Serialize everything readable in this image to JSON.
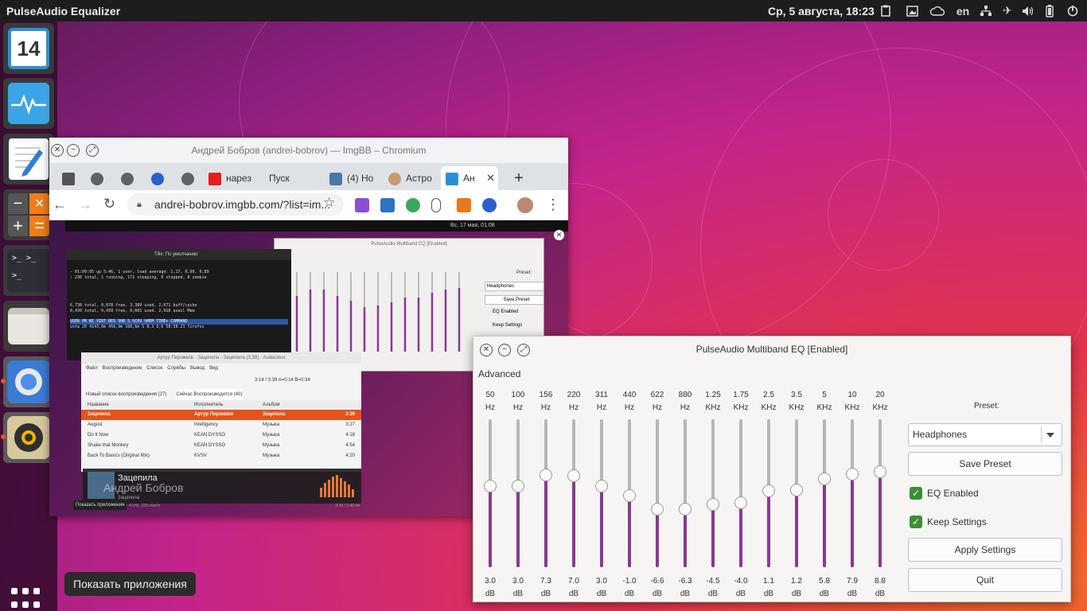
{
  "topbar": {
    "app_name": "PulseAudio Equalizer",
    "datetime": "Ср, 5 августа, 18:23",
    "language": "en"
  },
  "dock": {
    "items": [
      "calendar",
      "system-monitor",
      "text-editor",
      "calculator",
      "terminal",
      "files",
      "chromium",
      "rhythmbox"
    ],
    "show_apps_tooltip": "Показать приложения"
  },
  "chromium": {
    "window_title": "Андрей Бобров (andrei-bobrov) — ImgBB – Chromium",
    "tabs": [
      {
        "label": "нарез"
      },
      {
        "label": "Пуск"
      },
      {
        "label": "(4) Но"
      },
      {
        "label": "Астро"
      },
      {
        "label": "Ан"
      }
    ],
    "url": "andrei-bobrov.imgbb.com/?list=im...",
    "new_tab": "+",
    "content": {
      "panel_datetime": "Вс, 17 мая, 01:08",
      "terminal_title": "Tilix: По умолчанию",
      "top_lines": [
        "- 01:09:05 up  5:46,  1 user,  load average: 1,17, 0,99, 0,89",
        ": 236 total,   1 running, 171 sleeping,   0 stopped,   0 zombie",
        "6,738 total,   0,678 free,   3,389 used,   2,671 buff/cache",
        "0,439 total,   0,439 free,   0,001 used.   2,918 avail Mem"
      ],
      "top_header": "USER  PR  NI   VIRT   RES   SHR S  %CPU %MEM     TIME+  COMMAND",
      "top_row": "vota  20   4143,6m 456,9m 168,6m S  8,3  6,6  58:58.21  firefox",
      "audacious_title": "Артур Пирожков - Зацепила - Зацепила (3:39) - Audacious",
      "audacious_menu": [
        "Файл",
        "Воспроизведение",
        "Список",
        "Службы",
        "Вывод",
        "Вид"
      ],
      "audacious_time": "3:14 / 3:39 A=0:14 B=0:34",
      "playlist_tabs": [
        "Новый список воспроизведения (27)",
        "Сейчас Воспроизводится (40)"
      ],
      "playlist_headers": [
        "Название",
        "Исполнитель",
        "Альбом"
      ],
      "playlist_rows": [
        {
          "title": "Зацепила",
          "artist": "Артур Пирожков",
          "album": "Зацепила",
          "time": "3:39"
        },
        {
          "title": "August",
          "artist": "Intelligency",
          "album": "Музыка",
          "time": "3:27"
        },
        {
          "title": "Do It Now",
          "artist": "KEAN DYSSO",
          "album": "Музыка",
          "time": "4:18"
        },
        {
          "title": "Shake that Monkey",
          "artist": "KEAN DYSSO",
          "album": "Музыка",
          "time": "4:54"
        },
        {
          "title": "Back To Basics (Original Mix)",
          "artist": "KVSV",
          "album": "Музыка",
          "time": "4:20"
        }
      ],
      "status": "4 kHz, 320 кбит/с",
      "status_time": "3:39 / 2:40:44",
      "now_playing_title": "Зацепила",
      "now_playing_user": "Андрей Бобров",
      "now_playing_album": "Зацепила",
      "mini_eq_title": "PulseAudio Multiband EQ [Enabled]",
      "mini_preset_label": "Preset:",
      "mini_preset": "Headphones",
      "mini_save": "Save Preset",
      "mini_eq_enabled": "EQ Enabled",
      "mini_keep": "Keep Settings",
      "show_apps_tooltip": "Показать приложения"
    }
  },
  "eq": {
    "window_title": "PulseAudio Multiband EQ [Enabled]",
    "advanced_label": "Advanced",
    "bands": [
      {
        "freq": "50",
        "unit": "Hz",
        "value": "3.0",
        "db": "dB",
        "level": 3.0
      },
      {
        "freq": "100",
        "unit": "Hz",
        "value": "3.0",
        "db": "dB",
        "level": 3.0
      },
      {
        "freq": "156",
        "unit": "Hz",
        "value": "7.3",
        "db": "dB",
        "level": 7.3
      },
      {
        "freq": "220",
        "unit": "Hz",
        "value": "7.0",
        "db": "dB",
        "level": 7.0
      },
      {
        "freq": "311",
        "unit": "Hz",
        "value": "3.0",
        "db": "dB",
        "level": 3.0
      },
      {
        "freq": "440",
        "unit": "Hz",
        "value": "-1.0",
        "db": "dB",
        "level": -1.0
      },
      {
        "freq": "622",
        "unit": "Hz",
        "value": "-6.6",
        "db": "dB",
        "level": -6.6
      },
      {
        "freq": "880",
        "unit": "Hz",
        "value": "-6.3",
        "db": "dB",
        "level": -6.3
      },
      {
        "freq": "1.25",
        "unit": "KHz",
        "value": "-4.5",
        "db": "dB",
        "level": -4.5
      },
      {
        "freq": "1.75",
        "unit": "KHz",
        "value": "-4.0",
        "db": "dB",
        "level": -4.0
      },
      {
        "freq": "2.5",
        "unit": "KHz",
        "value": "1.1",
        "db": "dB",
        "level": 1.1
      },
      {
        "freq": "3.5",
        "unit": "KHz",
        "value": "1.2",
        "db": "dB",
        "level": 1.2
      },
      {
        "freq": "5",
        "unit": "KHz",
        "value": "5.8",
        "db": "dB",
        "level": 5.8
      },
      {
        "freq": "10",
        "unit": "KHz",
        "value": "7.9",
        "db": "dB",
        "level": 7.9
      },
      {
        "freq": "20",
        "unit": "KHz",
        "value": "8.8",
        "db": "dB",
        "level": 8.8
      }
    ],
    "slider_range": [
      -30,
      30
    ],
    "preset_label": "Preset:",
    "preset_value": "Headphones",
    "save_preset": "Save Preset",
    "eq_enabled_label": "EQ Enabled",
    "eq_enabled": true,
    "keep_settings_label": "Keep Settings",
    "keep_settings": true,
    "apply_settings": "Apply Settings",
    "quit": "Quit",
    "accent_color": "#873b8f",
    "check_color": "#3c8f37"
  }
}
